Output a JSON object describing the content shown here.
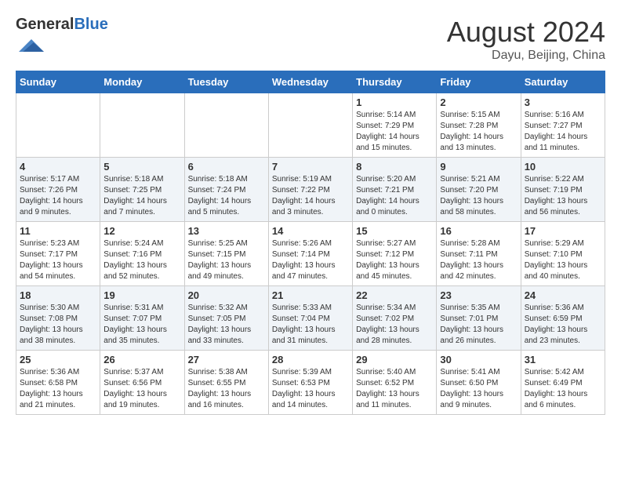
{
  "header": {
    "logo_general": "General",
    "logo_blue": "Blue",
    "month_title": "August 2024",
    "location": "Dayu, Beijing, China"
  },
  "weekdays": [
    "Sunday",
    "Monday",
    "Tuesday",
    "Wednesday",
    "Thursday",
    "Friday",
    "Saturday"
  ],
  "weeks": [
    [
      {
        "day": "",
        "sunrise": "",
        "sunset": "",
        "daylight": ""
      },
      {
        "day": "",
        "sunrise": "",
        "sunset": "",
        "daylight": ""
      },
      {
        "day": "",
        "sunrise": "",
        "sunset": "",
        "daylight": ""
      },
      {
        "day": "",
        "sunrise": "",
        "sunset": "",
        "daylight": ""
      },
      {
        "day": "1",
        "sunrise": "Sunrise: 5:14 AM",
        "sunset": "Sunset: 7:29 PM",
        "daylight": "Daylight: 14 hours and 15 minutes."
      },
      {
        "day": "2",
        "sunrise": "Sunrise: 5:15 AM",
        "sunset": "Sunset: 7:28 PM",
        "daylight": "Daylight: 14 hours and 13 minutes."
      },
      {
        "day": "3",
        "sunrise": "Sunrise: 5:16 AM",
        "sunset": "Sunset: 7:27 PM",
        "daylight": "Daylight: 14 hours and 11 minutes."
      }
    ],
    [
      {
        "day": "4",
        "sunrise": "Sunrise: 5:17 AM",
        "sunset": "Sunset: 7:26 PM",
        "daylight": "Daylight: 14 hours and 9 minutes."
      },
      {
        "day": "5",
        "sunrise": "Sunrise: 5:18 AM",
        "sunset": "Sunset: 7:25 PM",
        "daylight": "Daylight: 14 hours and 7 minutes."
      },
      {
        "day": "6",
        "sunrise": "Sunrise: 5:18 AM",
        "sunset": "Sunset: 7:24 PM",
        "daylight": "Daylight: 14 hours and 5 minutes."
      },
      {
        "day": "7",
        "sunrise": "Sunrise: 5:19 AM",
        "sunset": "Sunset: 7:22 PM",
        "daylight": "Daylight: 14 hours and 3 minutes."
      },
      {
        "day": "8",
        "sunrise": "Sunrise: 5:20 AM",
        "sunset": "Sunset: 7:21 PM",
        "daylight": "Daylight: 14 hours and 0 minutes."
      },
      {
        "day": "9",
        "sunrise": "Sunrise: 5:21 AM",
        "sunset": "Sunset: 7:20 PM",
        "daylight": "Daylight: 13 hours and 58 minutes."
      },
      {
        "day": "10",
        "sunrise": "Sunrise: 5:22 AM",
        "sunset": "Sunset: 7:19 PM",
        "daylight": "Daylight: 13 hours and 56 minutes."
      }
    ],
    [
      {
        "day": "11",
        "sunrise": "Sunrise: 5:23 AM",
        "sunset": "Sunset: 7:17 PM",
        "daylight": "Daylight: 13 hours and 54 minutes."
      },
      {
        "day": "12",
        "sunrise": "Sunrise: 5:24 AM",
        "sunset": "Sunset: 7:16 PM",
        "daylight": "Daylight: 13 hours and 52 minutes."
      },
      {
        "day": "13",
        "sunrise": "Sunrise: 5:25 AM",
        "sunset": "Sunset: 7:15 PM",
        "daylight": "Daylight: 13 hours and 49 minutes."
      },
      {
        "day": "14",
        "sunrise": "Sunrise: 5:26 AM",
        "sunset": "Sunset: 7:14 PM",
        "daylight": "Daylight: 13 hours and 47 minutes."
      },
      {
        "day": "15",
        "sunrise": "Sunrise: 5:27 AM",
        "sunset": "Sunset: 7:12 PM",
        "daylight": "Daylight: 13 hours and 45 minutes."
      },
      {
        "day": "16",
        "sunrise": "Sunrise: 5:28 AM",
        "sunset": "Sunset: 7:11 PM",
        "daylight": "Daylight: 13 hours and 42 minutes."
      },
      {
        "day": "17",
        "sunrise": "Sunrise: 5:29 AM",
        "sunset": "Sunset: 7:10 PM",
        "daylight": "Daylight: 13 hours and 40 minutes."
      }
    ],
    [
      {
        "day": "18",
        "sunrise": "Sunrise: 5:30 AM",
        "sunset": "Sunset: 7:08 PM",
        "daylight": "Daylight: 13 hours and 38 minutes."
      },
      {
        "day": "19",
        "sunrise": "Sunrise: 5:31 AM",
        "sunset": "Sunset: 7:07 PM",
        "daylight": "Daylight: 13 hours and 35 minutes."
      },
      {
        "day": "20",
        "sunrise": "Sunrise: 5:32 AM",
        "sunset": "Sunset: 7:05 PM",
        "daylight": "Daylight: 13 hours and 33 minutes."
      },
      {
        "day": "21",
        "sunrise": "Sunrise: 5:33 AM",
        "sunset": "Sunset: 7:04 PM",
        "daylight": "Daylight: 13 hours and 31 minutes."
      },
      {
        "day": "22",
        "sunrise": "Sunrise: 5:34 AM",
        "sunset": "Sunset: 7:02 PM",
        "daylight": "Daylight: 13 hours and 28 minutes."
      },
      {
        "day": "23",
        "sunrise": "Sunrise: 5:35 AM",
        "sunset": "Sunset: 7:01 PM",
        "daylight": "Daylight: 13 hours and 26 minutes."
      },
      {
        "day": "24",
        "sunrise": "Sunrise: 5:36 AM",
        "sunset": "Sunset: 6:59 PM",
        "daylight": "Daylight: 13 hours and 23 minutes."
      }
    ],
    [
      {
        "day": "25",
        "sunrise": "Sunrise: 5:36 AM",
        "sunset": "Sunset: 6:58 PM",
        "daylight": "Daylight: 13 hours and 21 minutes."
      },
      {
        "day": "26",
        "sunrise": "Sunrise: 5:37 AM",
        "sunset": "Sunset: 6:56 PM",
        "daylight": "Daylight: 13 hours and 19 minutes."
      },
      {
        "day": "27",
        "sunrise": "Sunrise: 5:38 AM",
        "sunset": "Sunset: 6:55 PM",
        "daylight": "Daylight: 13 hours and 16 minutes."
      },
      {
        "day": "28",
        "sunrise": "Sunrise: 5:39 AM",
        "sunset": "Sunset: 6:53 PM",
        "daylight": "Daylight: 13 hours and 14 minutes."
      },
      {
        "day": "29",
        "sunrise": "Sunrise: 5:40 AM",
        "sunset": "Sunset: 6:52 PM",
        "daylight": "Daylight: 13 hours and 11 minutes."
      },
      {
        "day": "30",
        "sunrise": "Sunrise: 5:41 AM",
        "sunset": "Sunset: 6:50 PM",
        "daylight": "Daylight: 13 hours and 9 minutes."
      },
      {
        "day": "31",
        "sunrise": "Sunrise: 5:42 AM",
        "sunset": "Sunset: 6:49 PM",
        "daylight": "Daylight: 13 hours and 6 minutes."
      }
    ]
  ]
}
